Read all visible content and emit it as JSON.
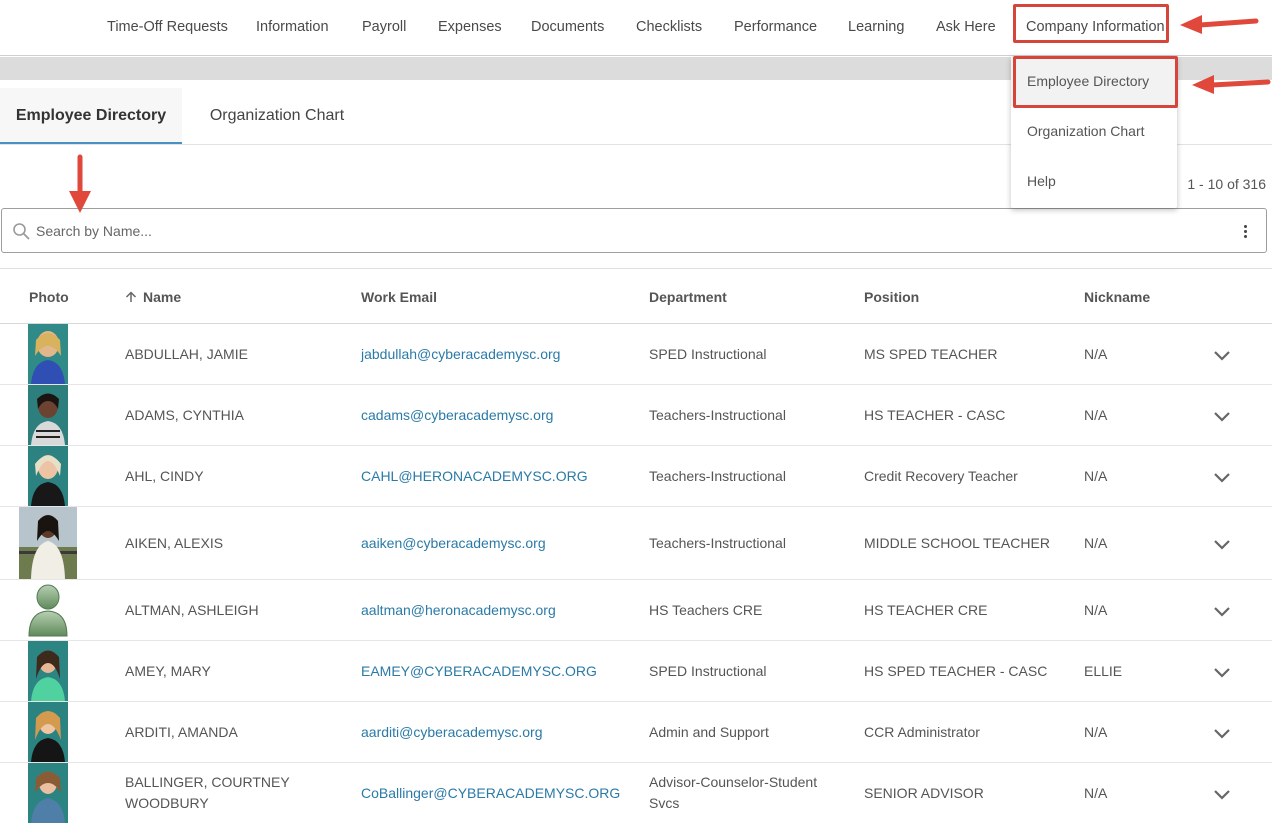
{
  "nav": {
    "items": [
      "Time-Off Requests",
      "Information",
      "Payroll",
      "Expenses",
      "Documents",
      "Checklists",
      "Performance",
      "Learning",
      "Ask Here",
      "Company Information"
    ]
  },
  "tabs": [
    "Employee Directory",
    "Organization Chart"
  ],
  "pager": "1 - 10 of 316",
  "search": {
    "placeholder": "Search by Name..."
  },
  "table": {
    "headers": [
      "Photo",
      "Name",
      "Work Email",
      "Department",
      "Position",
      "Nickname"
    ],
    "rows": [
      {
        "name": "ABDULLAH, JAMIE",
        "email": "jabdullah@cyberacademysc.org",
        "department": "SPED Instructional",
        "position": "MS SPED TEACHER",
        "nickname": "N/A"
      },
      {
        "name": "ADAMS, CYNTHIA",
        "email": "cadams@cyberacademysc.org",
        "department": "Teachers-Instructional",
        "position": "HS TEACHER - CASC",
        "nickname": "N/A"
      },
      {
        "name": "AHL, CINDY",
        "email": "CAHL@HERONACADEMYSC.ORG",
        "department": "Teachers-Instructional",
        "position": "Credit Recovery Teacher",
        "nickname": "N/A"
      },
      {
        "name": "AIKEN, ALEXIS",
        "email": "aaiken@cyberacademysc.org",
        "department": "Teachers-Instructional",
        "position": "MIDDLE SCHOOL TEACHER",
        "nickname": "N/A"
      },
      {
        "name": "ALTMAN, ASHLEIGH",
        "email": "aaltman@heronacademysc.org",
        "department": "HS Teachers CRE",
        "position": "HS TEACHER CRE",
        "nickname": "N/A"
      },
      {
        "name": "AMEY, MARY",
        "email": "EAMEY@CYBERACADEMYSC.ORG",
        "department": "SPED Instructional",
        "position": "HS SPED TEACHER - CASC",
        "nickname": "ELLIE"
      },
      {
        "name": "ARDITI, AMANDA",
        "email": "aarditi@cyberacademysc.org",
        "department": "Admin and Support",
        "position": "CCR Administrator",
        "nickname": "N/A"
      },
      {
        "name": "BALLINGER, COURTNEY WOODBURY",
        "email": "CoBallinger@CYBERACADEMYSC.ORG",
        "department": "Advisor-Counselor-Student Svcs",
        "position": "SENIOR ADVISOR",
        "nickname": "N/A"
      }
    ]
  },
  "dropdown": {
    "items": [
      "Employee Directory",
      "Organization Chart",
      "Help"
    ]
  },
  "colors": {
    "link": "#2a7aa8",
    "accent": "#4a90c2",
    "annotation": "#d6453b"
  }
}
